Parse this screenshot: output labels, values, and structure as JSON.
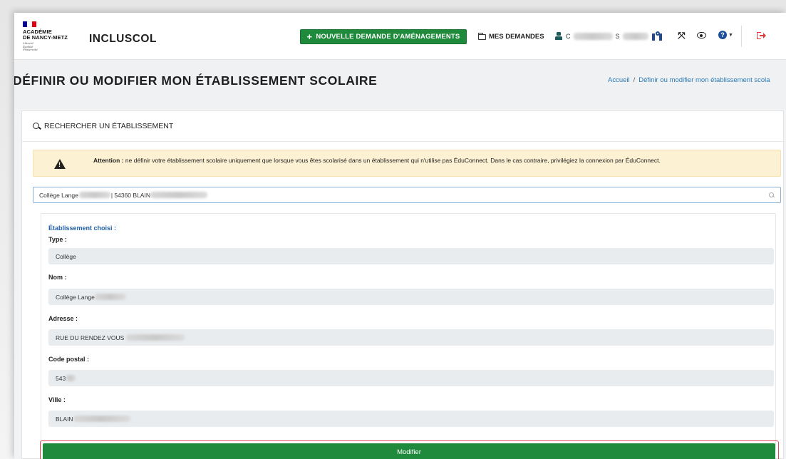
{
  "header": {
    "academy_lines": "ACADÉMIE\nDE NANCY-METZ",
    "motto": "Liberté\nÉgalité\nFraternité",
    "brand": "INCLUSCOL",
    "new_request_label": "NOUVELLE DEMANDE D'AMÉNAGEMENTS",
    "my_requests_label": "MES DEMANDES",
    "user_initial_1": "C",
    "user_initial_2": "S"
  },
  "page": {
    "title": "DÉFINIR OU MODIFIER MON ÉTABLISSEMENT SCOLAIRE",
    "breadcrumb_home": "Accueil",
    "breadcrumb_separator": "/",
    "breadcrumb_current": "Définir ou modifier mon établissement scola"
  },
  "search": {
    "section_title": "RECHERCHER UN ÉTABLISSEMENT",
    "alert_strong": "Attention :",
    "alert_text": " ne définir votre établissement scolaire uniquement que lorsque vous êtes scolarisé dans un établissement qui n'utilise pas ÉduConnect. Dans le cas contraire, privilégiez la connexion par ÉduConnect.",
    "value_part1": "Collège Lange",
    "value_part2": "| 54360 BLAIN"
  },
  "chosen": {
    "title": "Établissement choisi :",
    "fields": [
      {
        "label": "Type :",
        "value": "Collège"
      },
      {
        "label": "Nom :",
        "value": "Collège Lange"
      },
      {
        "label": "Adresse :",
        "value": "RUE DU RENDEZ VOUS"
      },
      {
        "label": "Code postal :",
        "value": "543"
      },
      {
        "label": "Ville :",
        "value": "BLAIN"
      }
    ],
    "modify_label": "Modifier"
  },
  "colors": {
    "primary_green": "#1f8a3b",
    "link_blue": "#2a7ab6",
    "alert_bg": "#fcf1d2",
    "highlight_red": "#e14a52"
  }
}
